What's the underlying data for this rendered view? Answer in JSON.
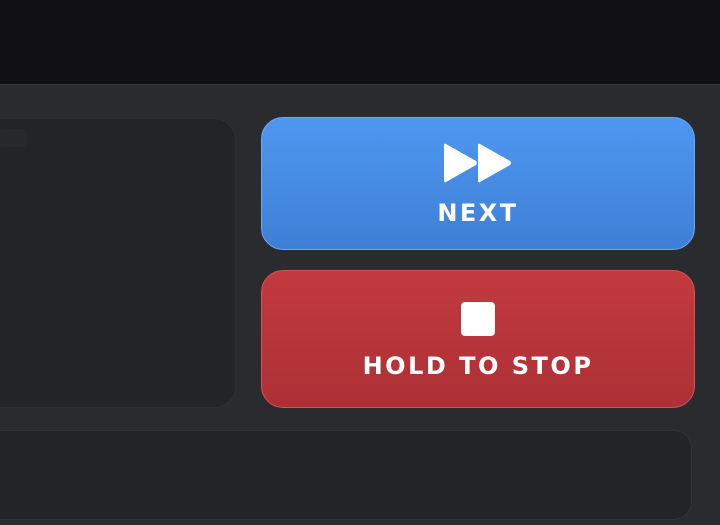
{
  "controls": {
    "next": {
      "label": "NEXT",
      "icon": "fast-forward-icon",
      "color": "#4a90e8"
    },
    "stop": {
      "label": "HOLD TO STOP",
      "icon": "stop-icon",
      "color": "#b83439"
    }
  }
}
